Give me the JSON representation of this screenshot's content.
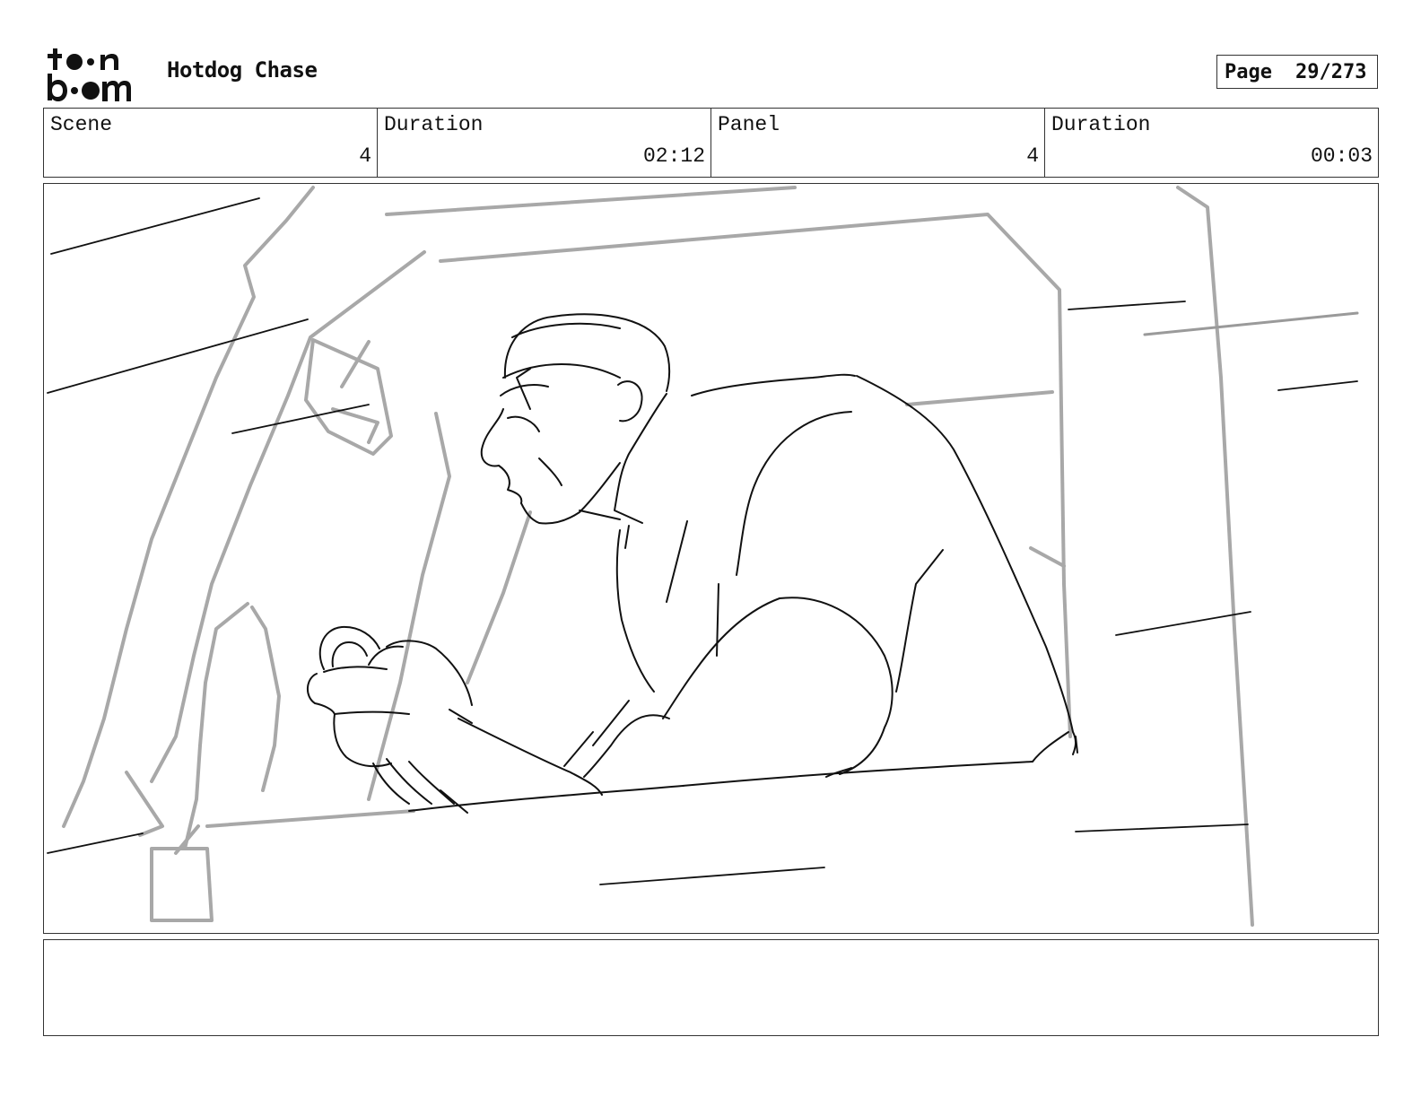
{
  "header": {
    "logo_text": "toon boom",
    "project_title": "Hotdog Chase",
    "page": {
      "label": "Page",
      "value": "29/273"
    }
  },
  "info": [
    {
      "label": "Scene",
      "value": "4"
    },
    {
      "label": "Duration",
      "value": "02:12"
    },
    {
      "label": "Panel",
      "value": "4"
    },
    {
      "label": "Duration",
      "value": "00:03"
    }
  ],
  "panel": {
    "subject": "driver-at-steering-wheel-sketch"
  },
  "notes": {
    "text": ""
  }
}
